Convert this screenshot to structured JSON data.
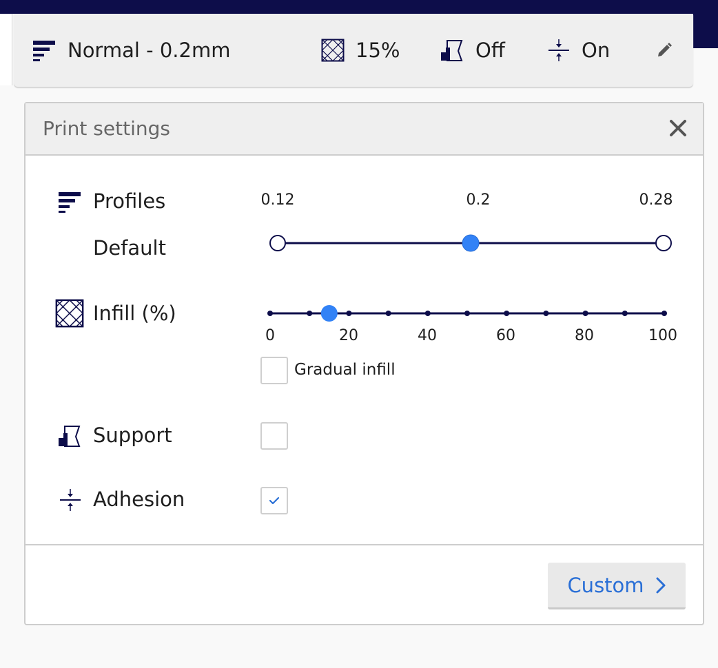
{
  "colors": {
    "accent": "#2a6fd6",
    "slider_handle": "#3282f6",
    "dark_navy": "#0d0d4a",
    "track": "#0d0d4a"
  },
  "header": {
    "profile_label": "Normal - 0.2mm",
    "infill_value": "15%",
    "support_value": "Off",
    "adhesion_value": "On",
    "icons": [
      "profile-lines-icon",
      "infill-pattern-icon",
      "support-block-icon",
      "adhesion-arrows-icon",
      "pencil-icon"
    ]
  },
  "panel": {
    "title": "Print settings",
    "close_icon": "close-icon",
    "profiles": {
      "label": "Profiles",
      "sublabel": "Default",
      "ticks": [
        "0.12",
        "0.2",
        "0.28"
      ],
      "selected": "0.2"
    },
    "infill": {
      "label": "Infill (%)",
      "tick_labels": [
        "0",
        "20",
        "40",
        "60",
        "80",
        "100"
      ],
      "value": 15,
      "gradual_label": "Gradual infill",
      "gradual_checked": false
    },
    "support": {
      "label": "Support",
      "checked": false
    },
    "adhesion": {
      "label": "Adhesion",
      "checked": true
    },
    "custom_button": "Custom"
  }
}
